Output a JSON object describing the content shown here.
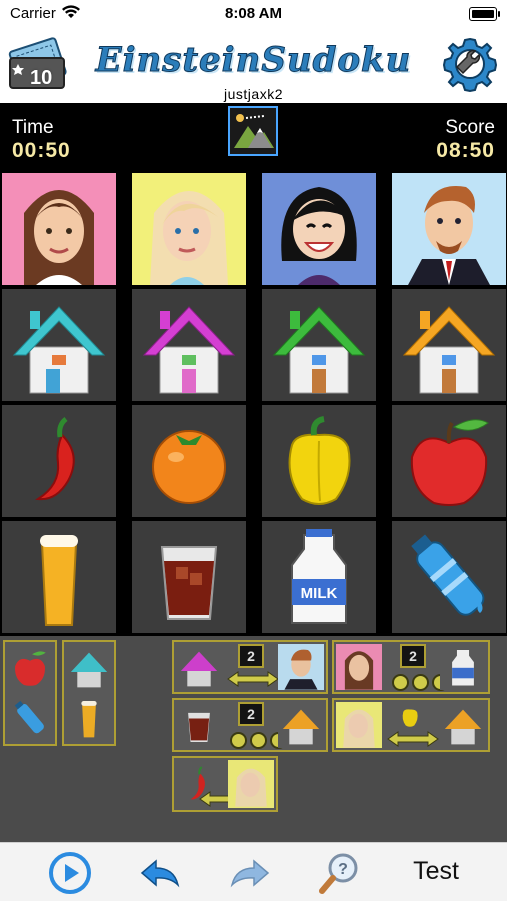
{
  "status_bar": {
    "carrier": "Carrier",
    "time": "8:08 AM"
  },
  "header": {
    "app_title": "EinsteinSudoku",
    "username": "justjaxk2",
    "ticket_count": "10",
    "ticket_icon": "ticket-icon",
    "settings_icon": "wrench-gear-icon"
  },
  "scorebar": {
    "time_label": "Time",
    "time_value": "00:50",
    "score_label": "Score",
    "score_value": "08:50",
    "hint_icon": "mountain-hint-icon"
  },
  "grid": {
    "rows": [
      [
        "woman-brunette",
        "woman-blonde",
        "woman-black-hair",
        "man-red-hair"
      ],
      [
        "cyan-house",
        "magenta-house",
        "green-house",
        "orange-house"
      ],
      [
        "chili-pepper",
        "orange-fruit",
        "yellow-bell-pepper",
        "red-apple"
      ],
      [
        "beer-glass",
        "cola-glass",
        "milk-jug",
        "water-bottle"
      ]
    ],
    "milk_label": "MILK"
  },
  "clues": {
    "vertical": [
      {
        "top": "red-apple",
        "bottom": "water-bottle"
      },
      {
        "top": "cyan-house",
        "bottom": "beer-glass"
      }
    ],
    "horizontal": [
      {
        "left": "magenta-house",
        "right": "man-red-hair",
        "number": "2",
        "relation": "adjacent"
      },
      {
        "left": "woman-brunette",
        "right": "milk-jug",
        "number": "2",
        "relation": "between"
      },
      {
        "left": "cola-glass",
        "right": "orange-house",
        "number": "2",
        "relation": "between"
      },
      {
        "left": "woman-blonde",
        "right": "orange-house",
        "middle": "yellow-bell-pepper",
        "relation": "adjacent"
      },
      {
        "left": "chili-pepper",
        "right": "woman-blonde",
        "relation": "adjacent"
      }
    ]
  },
  "toolbar": {
    "play_icon": "play-circle-icon",
    "undo_icon": "undo-arrow-icon",
    "redo_icon": "redo-arrow-icon",
    "hint_icon": "magnifier-question-icon",
    "test_label": "Test"
  },
  "colors": {
    "accent": "#2b7dba",
    "clue_border": "#b4a433",
    "score_text": "#f6e9a6"
  }
}
